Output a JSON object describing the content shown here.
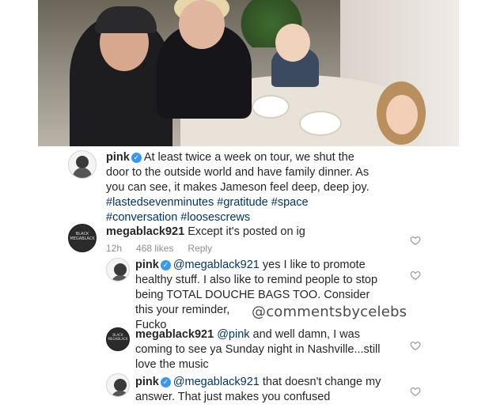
{
  "caption": {
    "username": "pink",
    "lines": [
      "At least twice a week on tour, we shut the",
      "door to the outside world and have family dinner. As",
      "you can see, it makes Jameson feel deep, deep joy."
    ],
    "hashtags_line1": "#lastedsevenminutes #gratitude #space",
    "hashtags_line2": "#conversation #loosescrews"
  },
  "comment1": {
    "username": "megablack921",
    "text": "Except it's posted on ig",
    "time": "12h",
    "likes": "468 likes",
    "reply": "Reply",
    "avatar_text": "BLACK MEGABLACK"
  },
  "reply1": {
    "username": "pink",
    "mention": "@megablack921",
    "line1": "yes I like to promote",
    "line2": "healthy stuff. I also like to remind people to stop",
    "line3": "being TOTAL DOUCHE BAGS TOO. Consider",
    "line4": "this your reminder,",
    "line5": "Fucko"
  },
  "reply2": {
    "username": "megablack921",
    "mention": "@pink",
    "line1": "and well damn, I was",
    "line2": "coming to see ya Sunday night in Nashville...still",
    "line3": "love the music",
    "avatar_text": "BLACK MEGABLACK"
  },
  "reply3": {
    "username": "pink",
    "mention": "@megablack921",
    "line1": "that doesn't change my",
    "line2": "answer. That just makes you confused"
  },
  "watermark": "@commentsbycelebs",
  "colors": {
    "verified": "#3897f0",
    "hashtag": "#003569",
    "meta": "#8e8e8e"
  }
}
